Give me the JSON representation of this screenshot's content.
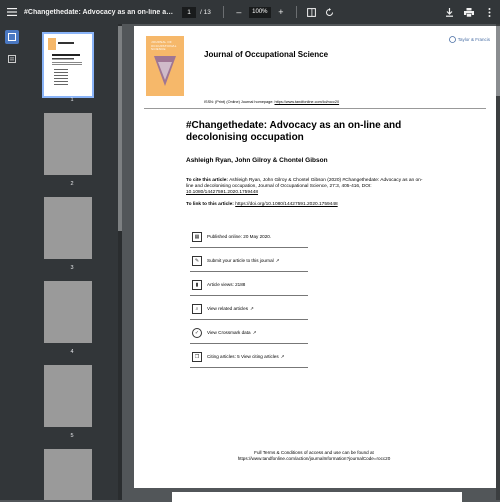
{
  "toolbar": {
    "title": "#Changethedate: Advocacy as an on-line and decolonisin...",
    "page_current": "1",
    "page_total": "/ 13",
    "zoom": "100%",
    "zoom_out": "–",
    "zoom_in": "+"
  },
  "sidebar": {
    "pages": [
      "1",
      "2",
      "3",
      "4",
      "5"
    ]
  },
  "page": {
    "cover_title": "JOURNAL OF OCCUPATIONAL SCIENCE",
    "journal_name": "Journal of Occupational Science",
    "publisher": "Taylor & Francis",
    "issn_label": "ISSN: (Print) (Online) Journal homepage:",
    "issn_url": "https://www.tandfonline.com/loi/rocc20",
    "article_title": "#Changethedate: Advocacy as an on-line and decolonising occupation",
    "authors": "Ashleigh Ryan, John Gilroy & Chontel Gibson",
    "cite_label": "To cite this article:",
    "cite_text": "Ashleigh Ryan, John Gilroy & Chontel Gibson (2020) #Changethedate: Advocacy as an on-line and decolonising occupation, Journal of Occupational Science, 27:3, 405-416, DOI:",
    "cite_doi": "10.1080/14427591.2020.1759448",
    "link_label": "To link to this article:",
    "link_url": "https://doi.org/10.1080/14427591.2020.1759448",
    "info": [
      {
        "icon": "calendar-icon",
        "text": "Published online: 20 May 2020."
      },
      {
        "icon": "edit-icon",
        "text": "Submit your article to this journal"
      },
      {
        "icon": "bar-chart-icon",
        "text": "Article views: 2188"
      },
      {
        "icon": "search-doc-icon",
        "text": "View related articles"
      },
      {
        "icon": "crossmark-icon",
        "text": "View Crossmark data"
      },
      {
        "icon": "citing-icon",
        "text": "Citing articles: 5 View citing articles"
      }
    ],
    "footer_line1": "Full Terms & Conditions of access and use can be found at",
    "footer_line2": "https://www.tandfonline.com/action/journalInformation?journalCode=rocc20"
  }
}
